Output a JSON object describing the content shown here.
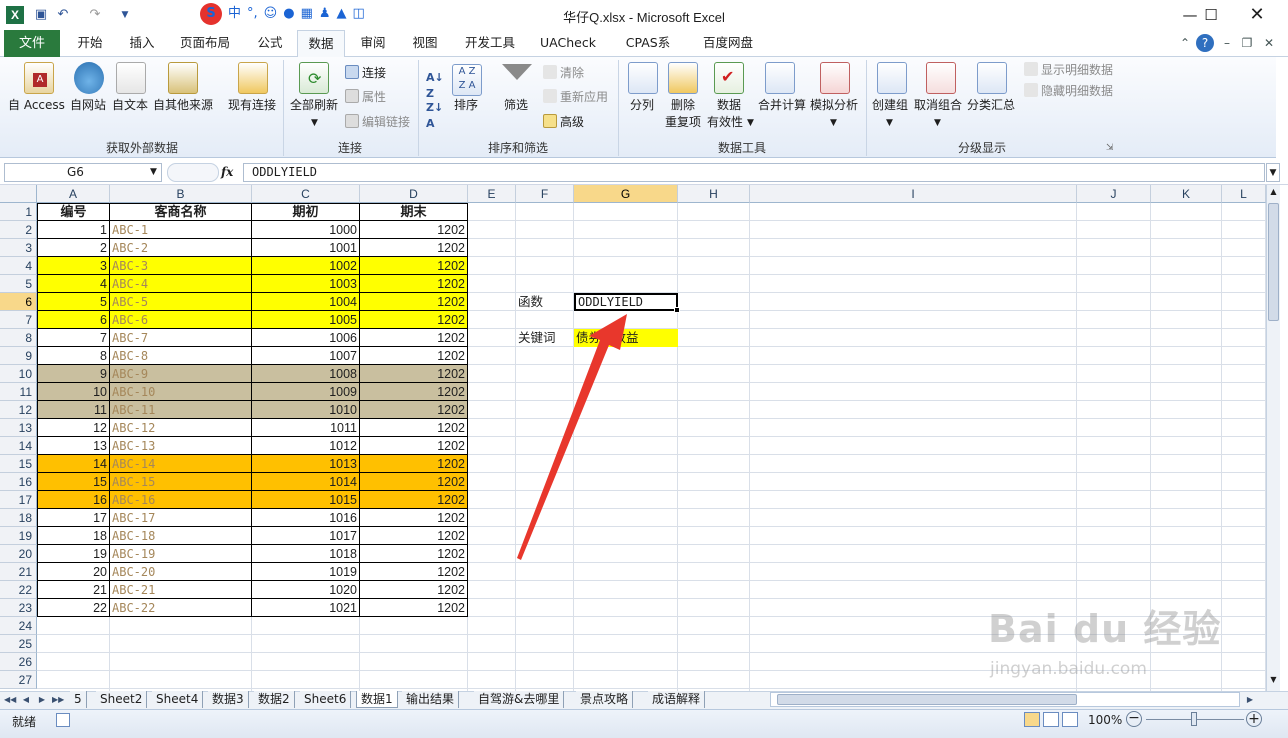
{
  "window": {
    "title": "华仔Q.xlsx  -  Microsoft Excel",
    "app_icon": "X"
  },
  "ime": {
    "logo": "S",
    "mode": "中",
    "punct": "°,",
    "icons": [
      "smiley-icon",
      "microphone-icon",
      "keyboard-icon",
      "user-icon",
      "shirt-icon",
      "grid-icon"
    ]
  },
  "ribbon_tabs": [
    "文件",
    "开始",
    "插入",
    "页面布局",
    "公式",
    "数据",
    "审阅",
    "视图",
    "开发工具",
    "UACheck",
    "CPAS系统",
    "百度网盘"
  ],
  "active_tab": "数据",
  "ribbon": {
    "get_external": {
      "btn1": "自 Access",
      "btn2": "自网站",
      "btn3": "自文本",
      "btn4": "自其他来源",
      "btn5": "现有连接",
      "label": "获取外部数据"
    },
    "connections": {
      "refresh_all": "全部刷新",
      "connections": "连接",
      "properties": "属性",
      "edit_links": "编辑链接",
      "label": "连接"
    },
    "sort_filter": {
      "sort": "排序",
      "filter": "筛选",
      "clear": "清除",
      "reapply": "重新应用",
      "advanced": "高级",
      "label": "排序和筛选"
    },
    "data_tools": {
      "split": "分列",
      "remove_dup1": "删除",
      "remove_dup2": "重复项",
      "validation1": "数据",
      "validation2": "有效性",
      "consolidate": "合并计算",
      "whatif": "模拟分析",
      "label": "数据工具"
    },
    "outline": {
      "group": "创建组",
      "ungroup": "取消组合",
      "subtotal": "分类汇总",
      "show_detail": "显示明细数据",
      "hide_detail": "隐藏明细数据",
      "label": "分级显示"
    }
  },
  "formula_bar": {
    "name_box": "G6",
    "fx": "fx",
    "formula": "ODDLYIELD"
  },
  "columns": [
    "A",
    "B",
    "C",
    "D",
    "E",
    "F",
    "G",
    "H",
    "I",
    "J",
    "K",
    "L"
  ],
  "rows": [
    "1",
    "2",
    "3",
    "4",
    "5",
    "6",
    "7",
    "8",
    "9",
    "10",
    "11",
    "12",
    "13",
    "14",
    "15",
    "16",
    "17",
    "18",
    "19",
    "20",
    "21",
    "22",
    "23",
    "24",
    "25",
    "26",
    "27"
  ],
  "table": {
    "headers": [
      "编号",
      "客商名称",
      "期初",
      "期末"
    ],
    "rows": [
      {
        "id": "1",
        "name": "ABC-1",
        "start": "1000",
        "end": "1202",
        "fill": "#ffffff"
      },
      {
        "id": "2",
        "name": "ABC-2",
        "start": "1001",
        "end": "1202",
        "fill": "#ffffff"
      },
      {
        "id": "3",
        "name": "ABC-3",
        "start": "1002",
        "end": "1202",
        "fill": "#ffff00"
      },
      {
        "id": "4",
        "name": "ABC-4",
        "start": "1003",
        "end": "1202",
        "fill": "#ffff00"
      },
      {
        "id": "5",
        "name": "ABC-5",
        "start": "1004",
        "end": "1202",
        "fill": "#ffff00"
      },
      {
        "id": "6",
        "name": "ABC-6",
        "start": "1005",
        "end": "1202",
        "fill": "#ffff00"
      },
      {
        "id": "7",
        "name": "ABC-7",
        "start": "1006",
        "end": "1202",
        "fill": "#ffffff"
      },
      {
        "id": "8",
        "name": "ABC-8",
        "start": "1007",
        "end": "1202",
        "fill": "#ffffff"
      },
      {
        "id": "9",
        "name": "ABC-9",
        "start": "1008",
        "end": "1202",
        "fill": "#c9bf9f"
      },
      {
        "id": "10",
        "name": "ABC-10",
        "start": "1009",
        "end": "1202",
        "fill": "#c9bf9f"
      },
      {
        "id": "11",
        "name": "ABC-11",
        "start": "1010",
        "end": "1202",
        "fill": "#c9bf9f"
      },
      {
        "id": "12",
        "name": "ABC-12",
        "start": "1011",
        "end": "1202",
        "fill": "#ffffff"
      },
      {
        "id": "13",
        "name": "ABC-13",
        "start": "1012",
        "end": "1202",
        "fill": "#ffffff"
      },
      {
        "id": "14",
        "name": "ABC-14",
        "start": "1013",
        "end": "1202",
        "fill": "#ffc000"
      },
      {
        "id": "15",
        "name": "ABC-15",
        "start": "1014",
        "end": "1202",
        "fill": "#ffc000"
      },
      {
        "id": "16",
        "name": "ABC-16",
        "start": "1015",
        "end": "1202",
        "fill": "#ffc000"
      },
      {
        "id": "17",
        "name": "ABC-17",
        "start": "1016",
        "end": "1202",
        "fill": "#ffffff"
      },
      {
        "id": "18",
        "name": "ABC-18",
        "start": "1017",
        "end": "1202",
        "fill": "#ffffff"
      },
      {
        "id": "19",
        "name": "ABC-19",
        "start": "1018",
        "end": "1202",
        "fill": "#ffffff"
      },
      {
        "id": "20",
        "name": "ABC-20",
        "start": "1019",
        "end": "1202",
        "fill": "#ffffff"
      },
      {
        "id": "21",
        "name": "ABC-21",
        "start": "1020",
        "end": "1202",
        "fill": "#ffffff"
      },
      {
        "id": "22",
        "name": "ABC-22",
        "start": "1021",
        "end": "1202",
        "fill": "#ffffff"
      }
    ]
  },
  "side": {
    "func_label": "函数",
    "func_value": "ODDLYIELD",
    "kw_label": "关键词",
    "kw_value": "债券的收益",
    "kw_fill": "#ffff00"
  },
  "sheet_tabs": [
    "5",
    "Sheet2",
    "Sheet4",
    "数据3",
    "数据2",
    "Sheet6",
    "数据1",
    "输出结果",
    "自驾游&去哪里",
    "景点攻略",
    "成语解释"
  ],
  "active_sheet": "数据1",
  "status": {
    "ready": "就绪",
    "zoom": "100%"
  },
  "watermark": {
    "brand": "Bai du 经验",
    "url": "jingyan.baidu.com"
  },
  "colors": {
    "excel_green": "#2a7a3d",
    "selection": "#f8d88a",
    "arrow": "#e8372c"
  }
}
